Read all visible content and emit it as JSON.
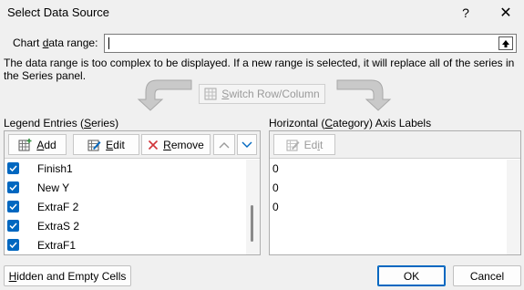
{
  "window": {
    "title": "Select Data Source",
    "help_glyph": "?",
    "close_glyph": "✕"
  },
  "range": {
    "label_pre": "Chart ",
    "label_u": "d",
    "label_post": "ata range:",
    "value": ""
  },
  "message": "The data range is too complex to be displayed. If a new range is selected, it will replace all of the series in the Series panel.",
  "switch": {
    "pre": "",
    "u": "S",
    "post": "witch Row/Column"
  },
  "legend": {
    "title_pre": "Legend Entries (",
    "title_u": "S",
    "title_post": "eries)",
    "add": {
      "u": "A",
      "post": "dd"
    },
    "edit": {
      "u": "E",
      "post": "dit"
    },
    "remove": {
      "u": "R",
      "post": "emove"
    },
    "items": [
      {
        "label": "Finish1",
        "checked": true
      },
      {
        "label": "New Y",
        "checked": true
      },
      {
        "label": "ExtraF 2",
        "checked": true
      },
      {
        "label": "ExtraS 2",
        "checked": true
      },
      {
        "label": "ExtraF1",
        "checked": true
      }
    ]
  },
  "axis": {
    "title_pre": "Horizontal (",
    "title_u": "C",
    "title_post": "ategory) Axis Labels",
    "edit": {
      "pre": "Ed",
      "u": "i",
      "post": "t"
    },
    "items": [
      "0",
      "0",
      "0"
    ]
  },
  "buttons": {
    "hidden": {
      "u": "H",
      "post": "idden and Empty Cells"
    },
    "ok": "OK",
    "cancel": "Cancel"
  },
  "colors": {
    "accent": "#0067c0",
    "disabled": "#9a9a9a"
  }
}
